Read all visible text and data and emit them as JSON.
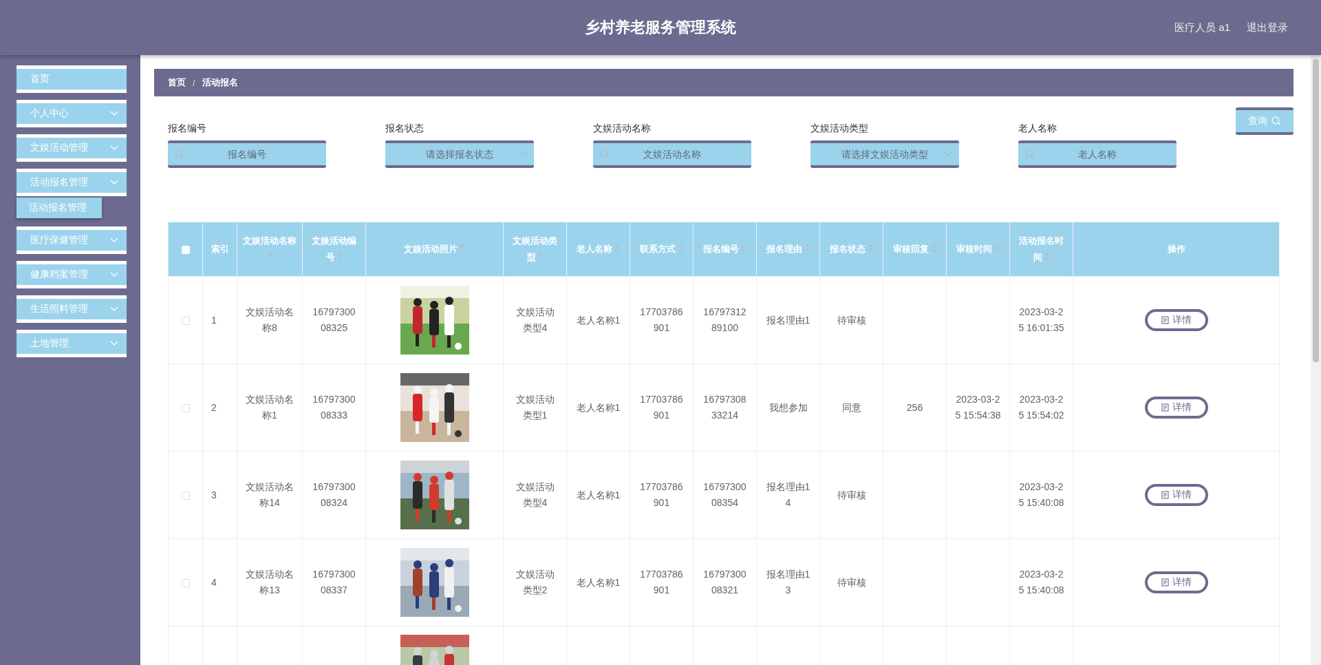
{
  "header": {
    "title": "乡村养老服务管理系统",
    "user": "医疗人员 a1",
    "logout": "退出登录"
  },
  "sidebar": {
    "items": [
      {
        "label": "首页",
        "kind": "link"
      },
      {
        "label": "个人中心",
        "kind": "menu"
      },
      {
        "label": "文娱活动管理",
        "kind": "menu"
      },
      {
        "label": "活动报名管理",
        "kind": "menu",
        "children": [
          {
            "label": "活动报名管理"
          }
        ]
      },
      {
        "label": "医疗保健管理",
        "kind": "menu"
      },
      {
        "label": "健康档案管理",
        "kind": "menu"
      },
      {
        "label": "生活照料管理",
        "kind": "menu"
      },
      {
        "label": "土地管理",
        "kind": "menu"
      }
    ]
  },
  "breadcrumb": {
    "items": [
      "首页",
      "活动报名"
    ],
    "separator": "/"
  },
  "search": {
    "fields": [
      {
        "label": "报名编号",
        "placeholder": "报名编号",
        "kind": "text"
      },
      {
        "label": "报名状态",
        "placeholder": "请选择报名状态",
        "kind": "select"
      },
      {
        "label": "文娱活动名称",
        "placeholder": "文娱活动名称",
        "kind": "text"
      },
      {
        "label": "文娱活动类型",
        "placeholder": "请选择文娱活动类型",
        "kind": "select"
      },
      {
        "label": "老人名称",
        "placeholder": "老人名称",
        "kind": "text"
      }
    ],
    "button": "查询"
  },
  "table": {
    "select_all": false,
    "columns": [
      {
        "label": "索引",
        "kind": "plain"
      },
      {
        "label": "文娱活动名称",
        "kind": "sortable"
      },
      {
        "label": "文娱活动编号",
        "kind": "sortable"
      },
      {
        "label": "文娱活动照片",
        "kind": "sortable"
      },
      {
        "label": "文娱活动类型",
        "kind": "sortable"
      },
      {
        "label": "老人名称",
        "kind": "sortable"
      },
      {
        "label": "联系方式",
        "kind": "sortable"
      },
      {
        "label": "报名编号",
        "kind": "sortable"
      },
      {
        "label": "报名理由",
        "kind": "sortable"
      },
      {
        "label": "报名状态",
        "kind": "sortable"
      },
      {
        "label": "审核回复",
        "kind": "sortable"
      },
      {
        "label": "审核时间",
        "kind": "sortable"
      },
      {
        "label": "活动报名时间",
        "kind": "sortable"
      },
      {
        "label": "操作",
        "kind": "plain"
      }
    ],
    "rows": [
      {
        "kind": "full",
        "checked": false,
        "cells": [
          "1",
          "文娱活动名称8",
          "1679730008325",
          null,
          "文娱活动类型4",
          "老人名称1",
          "17703786901",
          "1679731289100",
          "报名理由1",
          "待审核",
          "",
          "",
          "2023-03-25 16:01:35"
        ],
        "action": "详情"
      },
      {
        "kind": "full",
        "checked": false,
        "cells": [
          "2",
          "文娱活动名称1",
          "1679730008333",
          null,
          "文娱活动类型1",
          "老人名称1",
          "17703786901",
          "1679730833214",
          "我想参加",
          "同意",
          "256",
          "2023-03-25 15:54:38",
          "2023-03-25 15:54:02"
        ],
        "action": "详情"
      },
      {
        "kind": "full",
        "checked": false,
        "cells": [
          "3",
          "文娱活动名称14",
          "1679730008324",
          null,
          "文娱活动类型4",
          "老人名称1",
          "17703786901",
          "1679730008354",
          "报名理由14",
          "待审核",
          "",
          "",
          "2023-03-25 15:40:08"
        ],
        "action": "详情"
      },
      {
        "kind": "full",
        "checked": false,
        "cells": [
          "4",
          "文娱活动名称13",
          "1679730008337",
          null,
          "文娱活动类型2",
          "老人名称1",
          "17703786901",
          "1679730008321",
          "报名理由13",
          "待审核",
          "",
          "",
          "2023-03-25 15:40:08"
        ],
        "action": "详情"
      },
      {
        "kind": "partial"
      }
    ]
  }
}
